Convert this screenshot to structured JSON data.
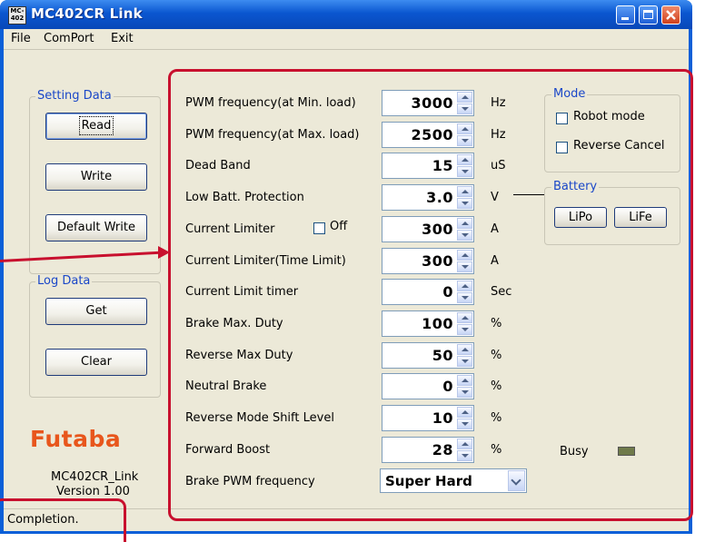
{
  "window": {
    "title": "MC402CR Link",
    "icon_text_top": "MC-",
    "icon_text_bottom": "402"
  },
  "menu": {
    "file": "File",
    "comport": "ComPort",
    "exit": "Exit"
  },
  "setting_data": {
    "legend": "Setting Data",
    "read": "Read",
    "write": "Write",
    "default_write": "Default Write"
  },
  "log_data": {
    "legend": "Log Data",
    "get": "Get",
    "clear": "Clear"
  },
  "brand": {
    "logo": "Futaba",
    "app_name": "MC402CR_Link",
    "version": "Version 1.00"
  },
  "params": [
    {
      "label": "PWM frequency(at Min. load)",
      "value": "3000",
      "unit": "Hz"
    },
    {
      "label": "PWM frequency(at Max. load)",
      "value": "2500",
      "unit": "Hz"
    },
    {
      "label": "Dead Band",
      "value": "15",
      "unit": "uS"
    },
    {
      "label": "Low Batt. Protection",
      "value": "3.0",
      "unit": "V"
    },
    {
      "label": "Current Limiter",
      "value": "300",
      "unit": "A"
    },
    {
      "label": "Current Limiter(Time Limit)",
      "value": "300",
      "unit": "A"
    },
    {
      "label": "Current Limit timer",
      "value": "0",
      "unit": "Sec"
    },
    {
      "label": "Brake Max. Duty",
      "value": "100",
      "unit": "%"
    },
    {
      "label": "Reverse Max Duty",
      "value": "50",
      "unit": "%"
    },
    {
      "label": "Neutral Brake",
      "value": "0",
      "unit": "%"
    },
    {
      "label": "Reverse Mode Shift Level",
      "value": "10",
      "unit": "%"
    },
    {
      "label": "Forward Boost",
      "value": "28",
      "unit": "%"
    }
  ],
  "current_limiter_off": {
    "label": "Off",
    "checked": false
  },
  "brake_pwm": {
    "label": "Brake PWM frequency",
    "value": "Super Hard"
  },
  "mode": {
    "legend": "Mode",
    "robot_mode": "Robot mode",
    "reverse_cancel": "Reverse Cancel"
  },
  "battery": {
    "legend": "Battery",
    "lipo": "LiPo",
    "life": "LiFe"
  },
  "busy": {
    "label": "Busy"
  },
  "status": {
    "text": "Completion."
  },
  "colors": {
    "accent": "#c8102e",
    "title_bar": "#0a56d0",
    "logo": "#e8561c"
  }
}
